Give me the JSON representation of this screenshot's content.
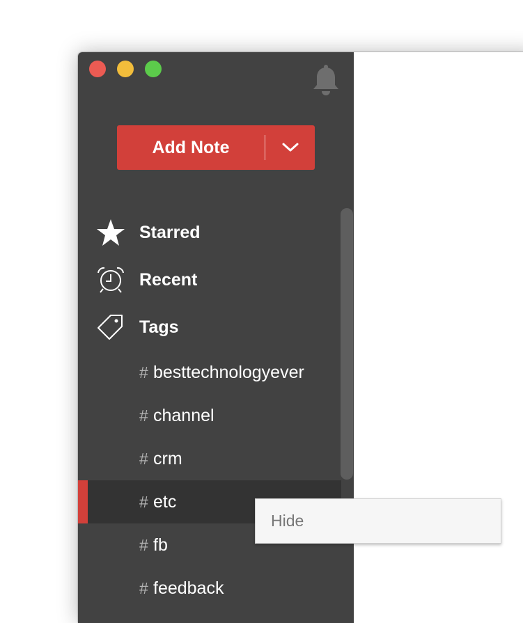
{
  "window": {
    "traffic_lights": {
      "close_color": "#ec5b53",
      "minimize_color": "#f2bd3b",
      "zoom_color": "#5ccb4b"
    },
    "notification_icon": "bell-icon"
  },
  "sidebar": {
    "add_note": {
      "label": "Add Note",
      "dropdown_icon": "chevron-down-icon",
      "color": "#d2403a"
    },
    "nav_items": [
      {
        "label": "Starred",
        "icon": "star-icon"
      },
      {
        "label": "Recent",
        "icon": "alarm-clock-icon"
      },
      {
        "label": "Tags",
        "icon": "tag-icon"
      }
    ],
    "tag_prefix": "#",
    "tags": [
      {
        "label": "besttechnologyever",
        "selected": false
      },
      {
        "label": "channel",
        "selected": false
      },
      {
        "label": "crm",
        "selected": false
      },
      {
        "label": "etc",
        "selected": true
      },
      {
        "label": "fb",
        "selected": false
      },
      {
        "label": "feedback",
        "selected": false
      }
    ],
    "colors": {
      "background": "#424242",
      "selected_row": "#333333",
      "accent": "#d2403a"
    }
  },
  "context_menu": {
    "items": [
      {
        "label": "Hide"
      }
    ]
  }
}
